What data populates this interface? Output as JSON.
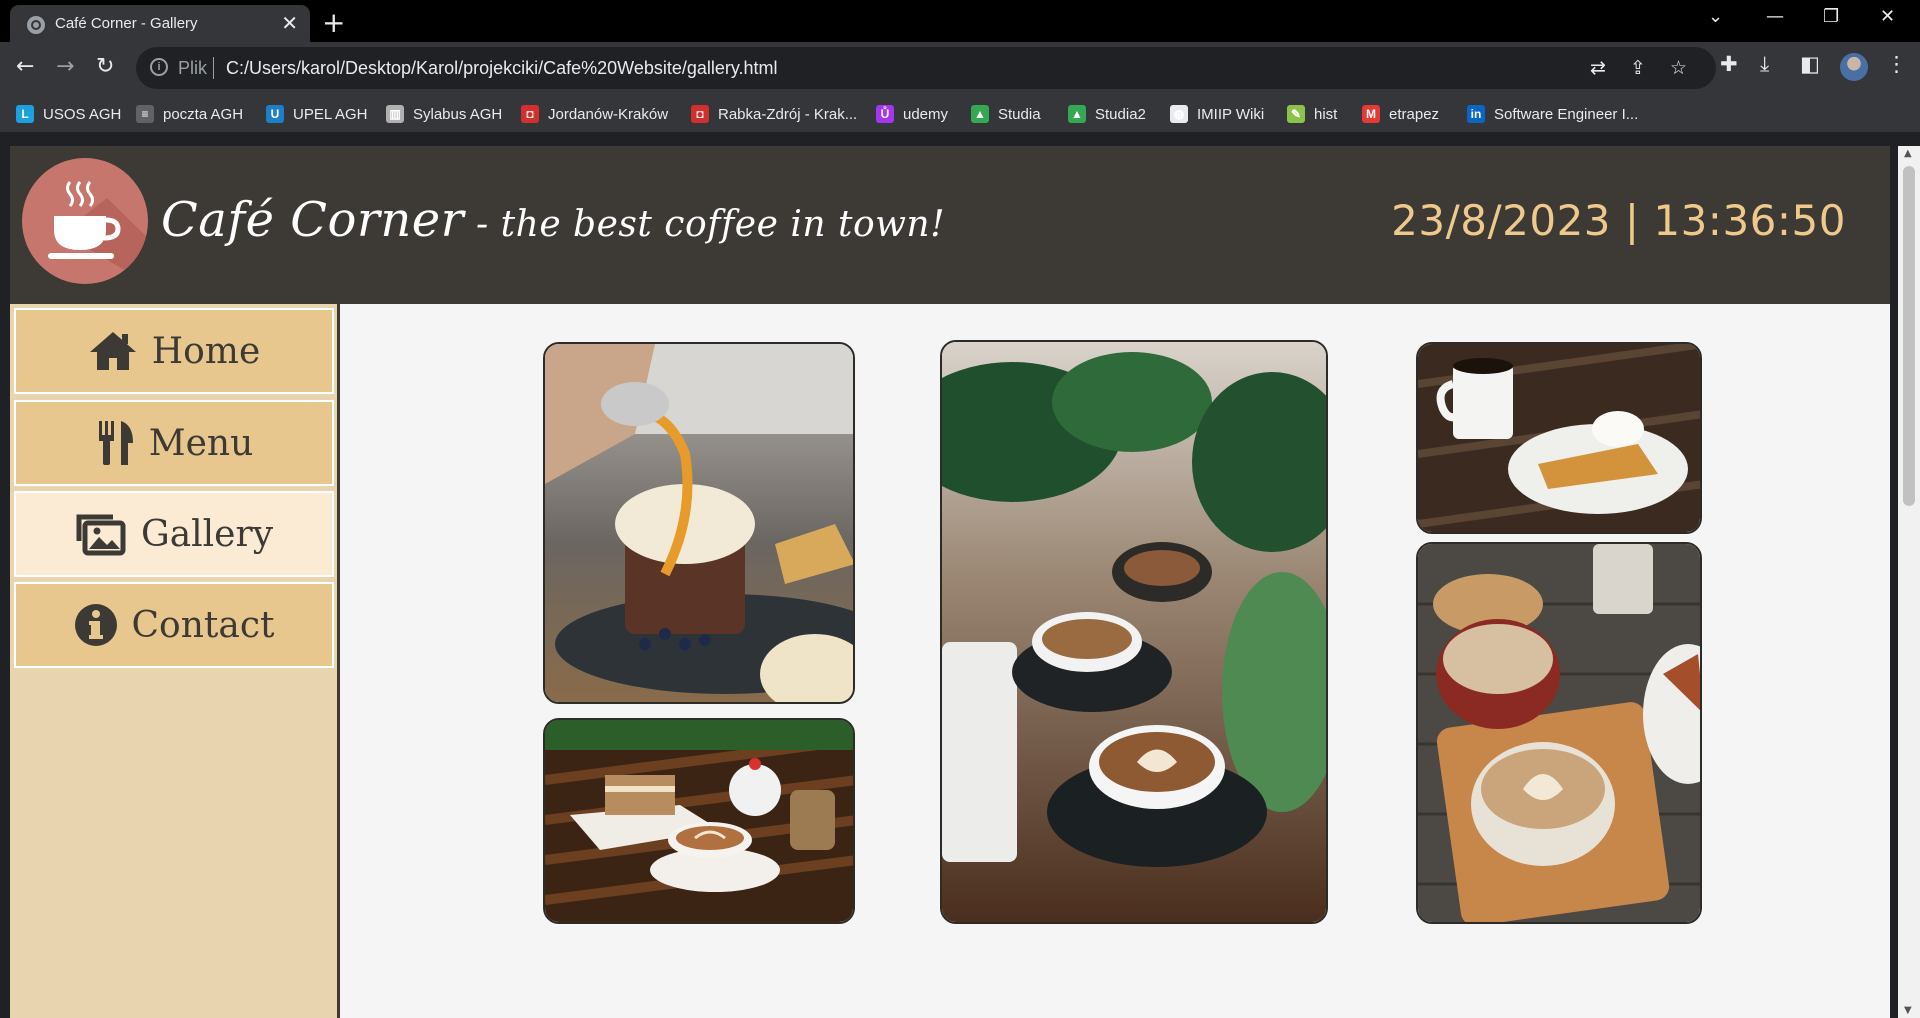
{
  "browser": {
    "tab_title": "Café Corner - Gallery",
    "address_prefix": "Plik",
    "url": "C:/Users/karol/Desktop/Karol/projekciki/Cafe%20Website/gallery.html",
    "bookmarks": [
      {
        "label": "USOS AGH",
        "icon": "usos-icon",
        "color": "#1ba1e2",
        "glyph": "L"
      },
      {
        "label": "poczta AGH",
        "icon": "mail-icon",
        "color": "#5f6368",
        "glyph": "≡"
      },
      {
        "label": "UPEL AGH",
        "icon": "upel-icon",
        "color": "#1e7fc6",
        "glyph": "U"
      },
      {
        "label": "Sylabus AGH",
        "icon": "sylabus-icon",
        "color": "#b0b0b0",
        "glyph": "▥"
      },
      {
        "label": "Jordanów-Kraków",
        "icon": "bus-icon",
        "color": "#d32f2f",
        "glyph": "◘"
      },
      {
        "label": "Rabka-Zdrój - Krak...",
        "icon": "bus-icon",
        "color": "#d32f2f",
        "glyph": "◘"
      },
      {
        "label": "udemy",
        "icon": "udemy-icon",
        "color": "#a435f0",
        "glyph": "Ů"
      },
      {
        "label": "Studia",
        "icon": "drive-icon",
        "color": "#34a853",
        "glyph": "▲"
      },
      {
        "label": "Studia2",
        "icon": "drive-icon",
        "color": "#34a853",
        "glyph": "▲"
      },
      {
        "label": "IMIIP Wiki",
        "icon": "globe-icon",
        "color": "#e8eaed",
        "glyph": "◍"
      },
      {
        "label": "hist",
        "icon": "hist-icon",
        "color": "#8bc34a",
        "glyph": "✎"
      },
      {
        "label": "etrapez",
        "icon": "etrapez-icon",
        "color": "#e53935",
        "glyph": "M"
      },
      {
        "label": "Software Engineer I...",
        "icon": "linkedin-icon",
        "color": "#0a66c2",
        "glyph": "in"
      }
    ]
  },
  "site": {
    "brand": "Café Corner",
    "tagline": " - the best coffee in town!",
    "clock": "23/8/2023 | 13:36:50",
    "nav": [
      {
        "label": "Home",
        "icon": "home-icon",
        "active": false
      },
      {
        "label": "Menu",
        "icon": "utensils-icon",
        "active": false
      },
      {
        "label": "Gallery",
        "icon": "images-icon",
        "active": true
      },
      {
        "label": "Contact",
        "icon": "info-icon",
        "active": false
      }
    ],
    "gallery": [
      {
        "subject": "dessert with caramel sauce"
      },
      {
        "subject": "cake and latte on wooden table"
      },
      {
        "subject": "latte art cups with plants"
      },
      {
        "subject": "coffee mug and pie slice"
      },
      {
        "subject": "two lattes on wooden tray"
      }
    ]
  },
  "colors": {
    "header_bg": "#3d3a35",
    "clock": "#efc98c",
    "nav_bg": "#e8c78e",
    "nav_active": "#fbebd5",
    "sidebar_bg": "#e8d5b0",
    "logo_bg": "#c7766d"
  }
}
